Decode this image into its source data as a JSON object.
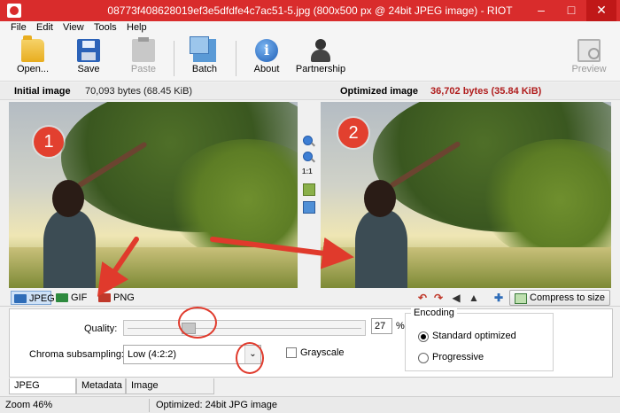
{
  "window": {
    "title": "08773f408628019ef3e5dfdfe4c7ac51-5.jpg (800x500 px @ 24bit JPEG image) - RIOT"
  },
  "menu": [
    "File",
    "Edit",
    "View",
    "Tools",
    "Help"
  ],
  "toolbar": {
    "open": "Open...",
    "save": "Save",
    "paste": "Paste",
    "batch": "Batch",
    "about": "About",
    "partnership": "Partnership",
    "preview": "Preview"
  },
  "info": {
    "initial_label": "Initial image",
    "initial_size": "70,093 bytes (68.45 KiB)",
    "optimized_label": "Optimized image",
    "optimized_size": "36,702 bytes (35.84 KiB)"
  },
  "panes": {
    "badge_left": "1",
    "badge_right": "2"
  },
  "zoom_tools": {
    "actual_size": "1:1"
  },
  "formats": [
    "JPEG",
    "GIF",
    "PNG"
  ],
  "selected_format": "JPEG",
  "actions": {
    "compress_to_size": "Compress to size"
  },
  "options": {
    "quality_label": "Quality:",
    "quality_value": "27",
    "quality_unit": "%",
    "quality_fraction": 0.27,
    "chroma_label": "Chroma subsampling:",
    "chroma_value": "Low (4:2:2)",
    "grayscale_label": "Grayscale",
    "grayscale_checked": false,
    "encoding_title": "Encoding",
    "encoding_options": [
      "Standard optimized",
      "Progressive"
    ],
    "encoding_selected": "Standard optimized"
  },
  "bottom_tabs": [
    "JPEG Options",
    "Metadata",
    "Image adjustments"
  ],
  "status": {
    "zoom": "Zoom 46%",
    "message": "Optimized: 24bit JPG image"
  },
  "colors": {
    "titlebar": "#d92c2c",
    "annotation": "#e03a2c",
    "optimized_size": "#b01d1d"
  }
}
